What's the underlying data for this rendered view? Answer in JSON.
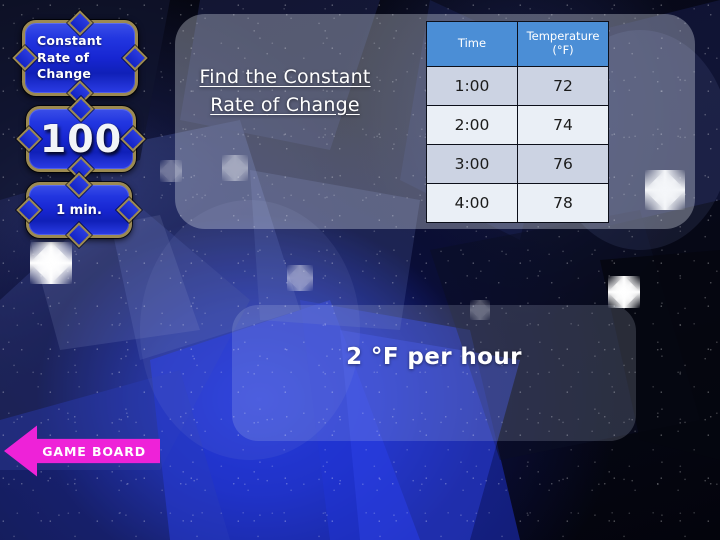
{
  "slide": {
    "category": "Constant\nRate of\nChange",
    "points": "100",
    "timer": "1 min.",
    "question_title": "Find the Constant Rate of Change",
    "answer": "2 °F per hour"
  },
  "table": {
    "headers": [
      "Time",
      "Temperature (°F)"
    ],
    "header_time": "Time",
    "header_temp_line1": "Temperature",
    "header_temp_line2": "(°F)",
    "rows": [
      {
        "time": "1:00",
        "temp": "72"
      },
      {
        "time": "2:00",
        "temp": "74"
      },
      {
        "time": "3:00",
        "temp": "76"
      },
      {
        "time": "4:00",
        "temp": "78"
      }
    ]
  },
  "nav": {
    "game_board_label": "GAME BOARD"
  },
  "colors": {
    "table_header_bg": "#4b8ed6",
    "table_row_odd_bg": "#ccd3e3",
    "table_row_even_bg": "#eaeff6",
    "plaque_blue": "#1726d2",
    "plaque_border_gold": "#9c8a52",
    "game_board_magenta": "#ee22d8",
    "text_white": "#ffffff"
  }
}
